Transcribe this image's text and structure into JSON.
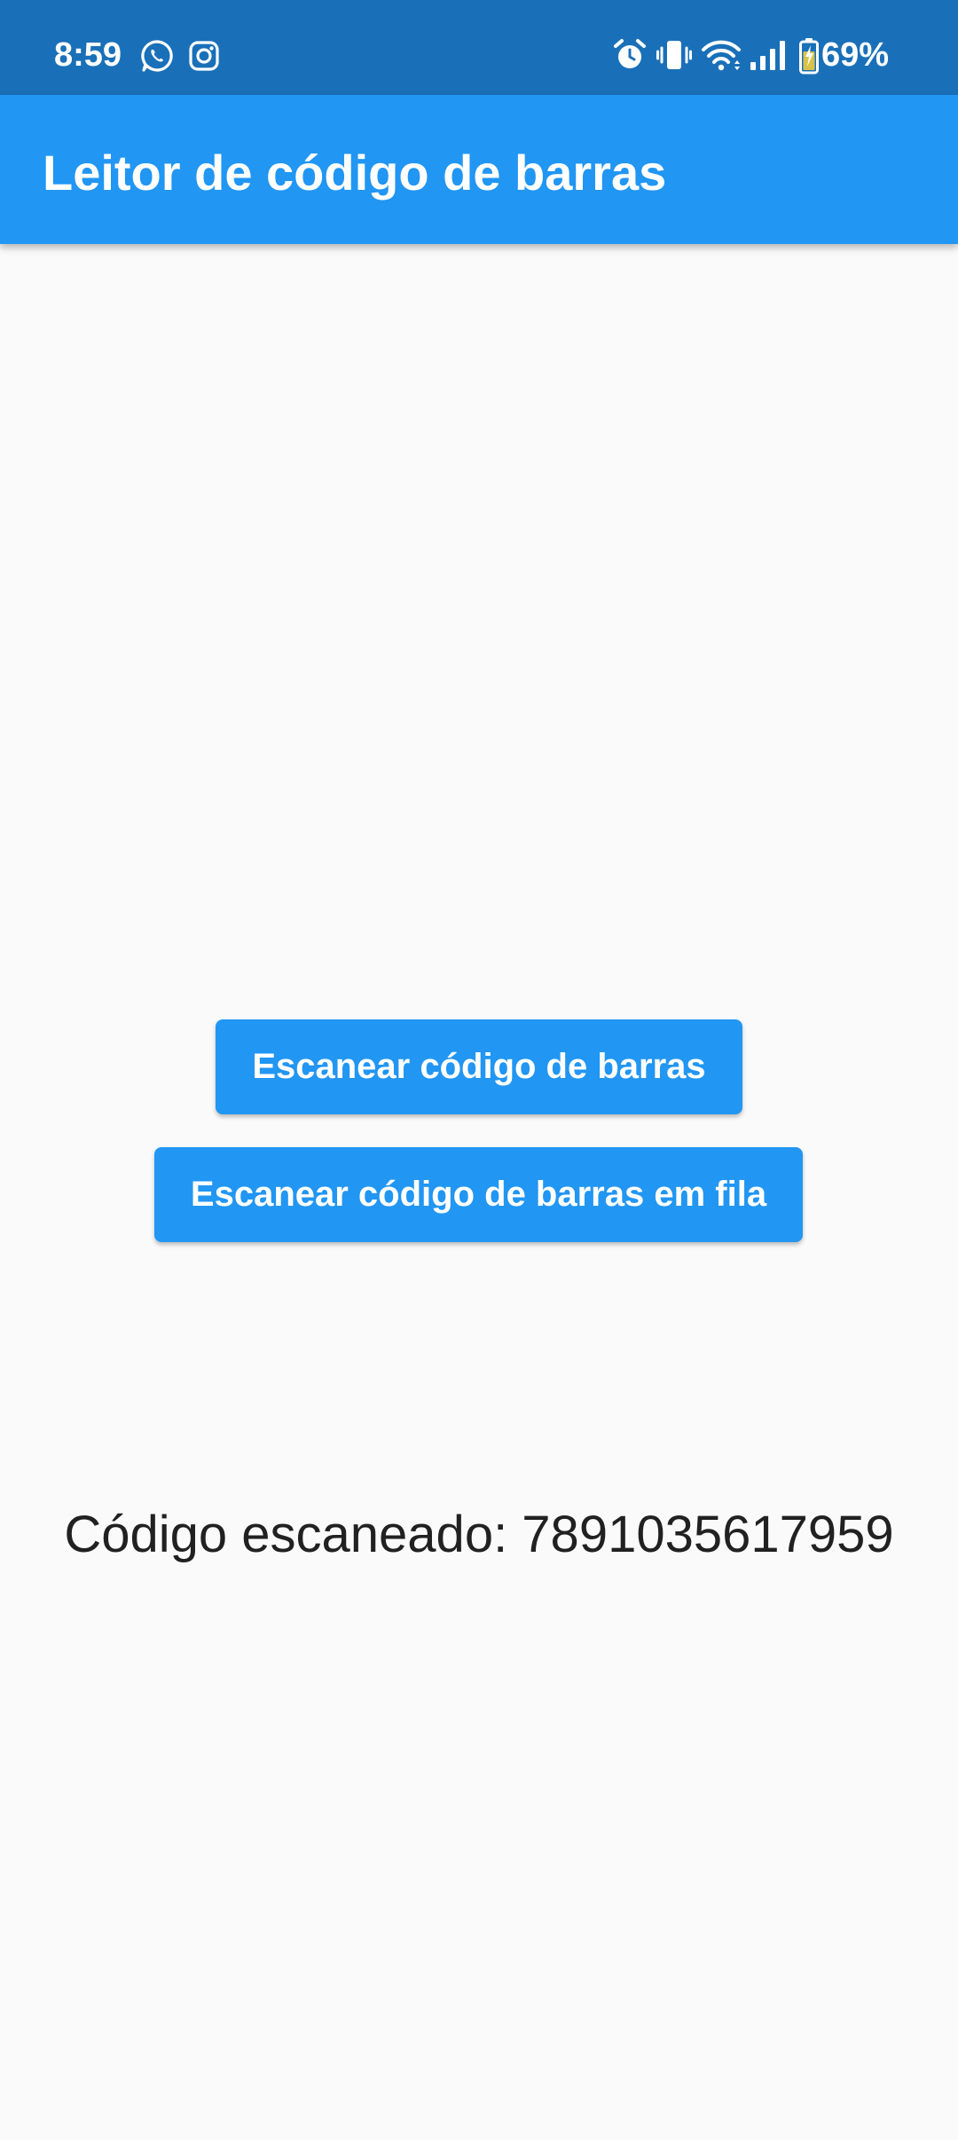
{
  "status_bar": {
    "time": "8:59",
    "battery_percent": "69%",
    "background_color": "#1a70b8",
    "left_icons": [
      "whatsapp-icon",
      "instagram-icon"
    ],
    "right_icons": [
      "alarm-icon",
      "vibrate-icon",
      "wifi-icon",
      "signal-icon",
      "battery-charging-icon"
    ]
  },
  "app_bar": {
    "title": "Leitor de código de barras",
    "color": "#2196f3"
  },
  "main": {
    "scan_button_label": "Escanear código de barras",
    "scan_queue_button_label": "Escanear código de barras em fila",
    "scanned_result": "Código escaneado: 7891035617959"
  }
}
